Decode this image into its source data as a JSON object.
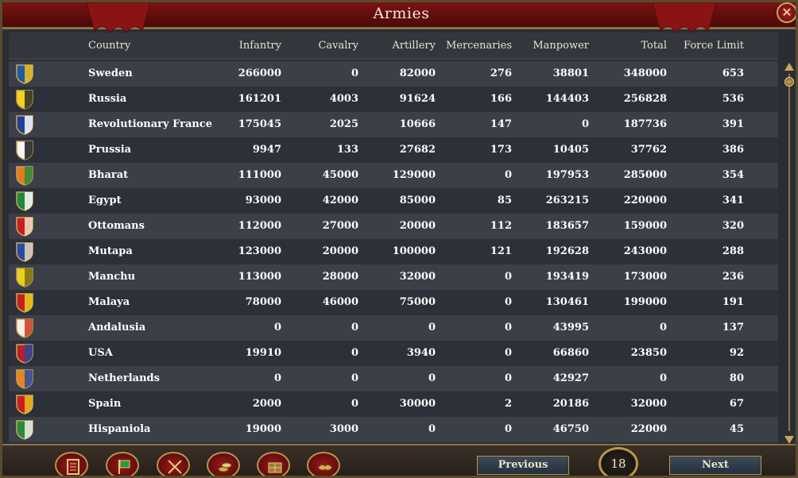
{
  "window": {
    "title": "Armies"
  },
  "table": {
    "headers": {
      "country": "Country",
      "infantry": "Infantry",
      "cavalry": "Cavalry",
      "artillery": "Artillery",
      "mercenaries": "Mercenaries",
      "manpower": "Manpower",
      "total": "Total",
      "force_limit": "Force Limit"
    },
    "rows": [
      {
        "country": "Sweden",
        "infantry": "266000",
        "cavalry": "0",
        "artillery": "82000",
        "mercenaries": "276",
        "manpower": "38801",
        "total": "348000",
        "force_limit": "653"
      },
      {
        "country": "Russia",
        "infantry": "161201",
        "cavalry": "4003",
        "artillery": "91624",
        "mercenaries": "166",
        "manpower": "144403",
        "total": "256828",
        "force_limit": "536"
      },
      {
        "country": "Revolutionary France",
        "infantry": "175045",
        "cavalry": "2025",
        "artillery": "10666",
        "mercenaries": "147",
        "manpower": "0",
        "total": "187736",
        "force_limit": "391"
      },
      {
        "country": "Prussia",
        "infantry": "9947",
        "cavalry": "133",
        "artillery": "27682",
        "mercenaries": "173",
        "manpower": "10405",
        "total": "37762",
        "force_limit": "386"
      },
      {
        "country": "Bharat",
        "infantry": "111000",
        "cavalry": "45000",
        "artillery": "129000",
        "mercenaries": "0",
        "manpower": "197953",
        "total": "285000",
        "force_limit": "354"
      },
      {
        "country": "Egypt",
        "infantry": "93000",
        "cavalry": "42000",
        "artillery": "85000",
        "mercenaries": "85",
        "manpower": "263215",
        "total": "220000",
        "force_limit": "341"
      },
      {
        "country": "Ottomans",
        "infantry": "112000",
        "cavalry": "27000",
        "artillery": "20000",
        "mercenaries": "112",
        "manpower": "183657",
        "total": "159000",
        "force_limit": "320"
      },
      {
        "country": "Mutapa",
        "infantry": "123000",
        "cavalry": "20000",
        "artillery": "100000",
        "mercenaries": "121",
        "manpower": "192628",
        "total": "243000",
        "force_limit": "288"
      },
      {
        "country": "Manchu",
        "infantry": "113000",
        "cavalry": "28000",
        "artillery": "32000",
        "mercenaries": "0",
        "manpower": "193419",
        "total": "173000",
        "force_limit": "236"
      },
      {
        "country": "Malaya",
        "infantry": "78000",
        "cavalry": "46000",
        "artillery": "75000",
        "mercenaries": "0",
        "manpower": "130461",
        "total": "199000",
        "force_limit": "191"
      },
      {
        "country": "Andalusia",
        "infantry": "0",
        "cavalry": "0",
        "artillery": "0",
        "mercenaries": "0",
        "manpower": "43995",
        "total": "0",
        "force_limit": "137"
      },
      {
        "country": "USA",
        "infantry": "19910",
        "cavalry": "0",
        "artillery": "3940",
        "mercenaries": "0",
        "manpower": "66860",
        "total": "23850",
        "force_limit": "92"
      },
      {
        "country": "Netherlands",
        "infantry": "0",
        "cavalry": "0",
        "artillery": "0",
        "mercenaries": "0",
        "manpower": "42927",
        "total": "0",
        "force_limit": "80"
      },
      {
        "country": "Spain",
        "infantry": "2000",
        "cavalry": "0",
        "artillery": "30000",
        "mercenaries": "2",
        "manpower": "20186",
        "total": "32000",
        "force_limit": "67"
      },
      {
        "country": "Hispaniola",
        "infantry": "19000",
        "cavalry": "3000",
        "artillery": "0",
        "mercenaries": "0",
        "manpower": "46750",
        "total": "22000",
        "force_limit": "45"
      }
    ],
    "flag_colors": [
      [
        "#1e5aa8",
        "#f2c21a"
      ],
      [
        "#f2d21a",
        "#2a2a2a"
      ],
      [
        "#1f3f9a",
        "#ffffff"
      ],
      [
        "#f5f5f5",
        "#1a1a1a"
      ],
      [
        "#e67a1e",
        "#2a8a3a"
      ],
      [
        "#1e8a3a",
        "#ffffff"
      ],
      [
        "#c81e1e",
        "#f5e6c8"
      ],
      [
        "#2a4aa8",
        "#e8d9b8"
      ],
      [
        "#e8d21a",
        "#7a6a1a"
      ],
      [
        "#c81e1e",
        "#e8d21a"
      ],
      [
        "#f5f0e8",
        "#c83a1e"
      ],
      [
        "#b81e2a",
        "#2a4a9a"
      ],
      [
        "#e8841e",
        "#2a4aa8"
      ],
      [
        "#c81e1e",
        "#e8c21a"
      ],
      [
        "#2a8a3a",
        "#f5f0e8"
      ]
    ]
  },
  "bottom_bar": {
    "tabs": [
      "ledger-icon",
      "flag-icon",
      "crossed-swords-icon",
      "coins-icon",
      "crate-icon",
      "handshake-icon"
    ],
    "previous_label": "Previous",
    "next_label": "Next",
    "page": "18"
  }
}
